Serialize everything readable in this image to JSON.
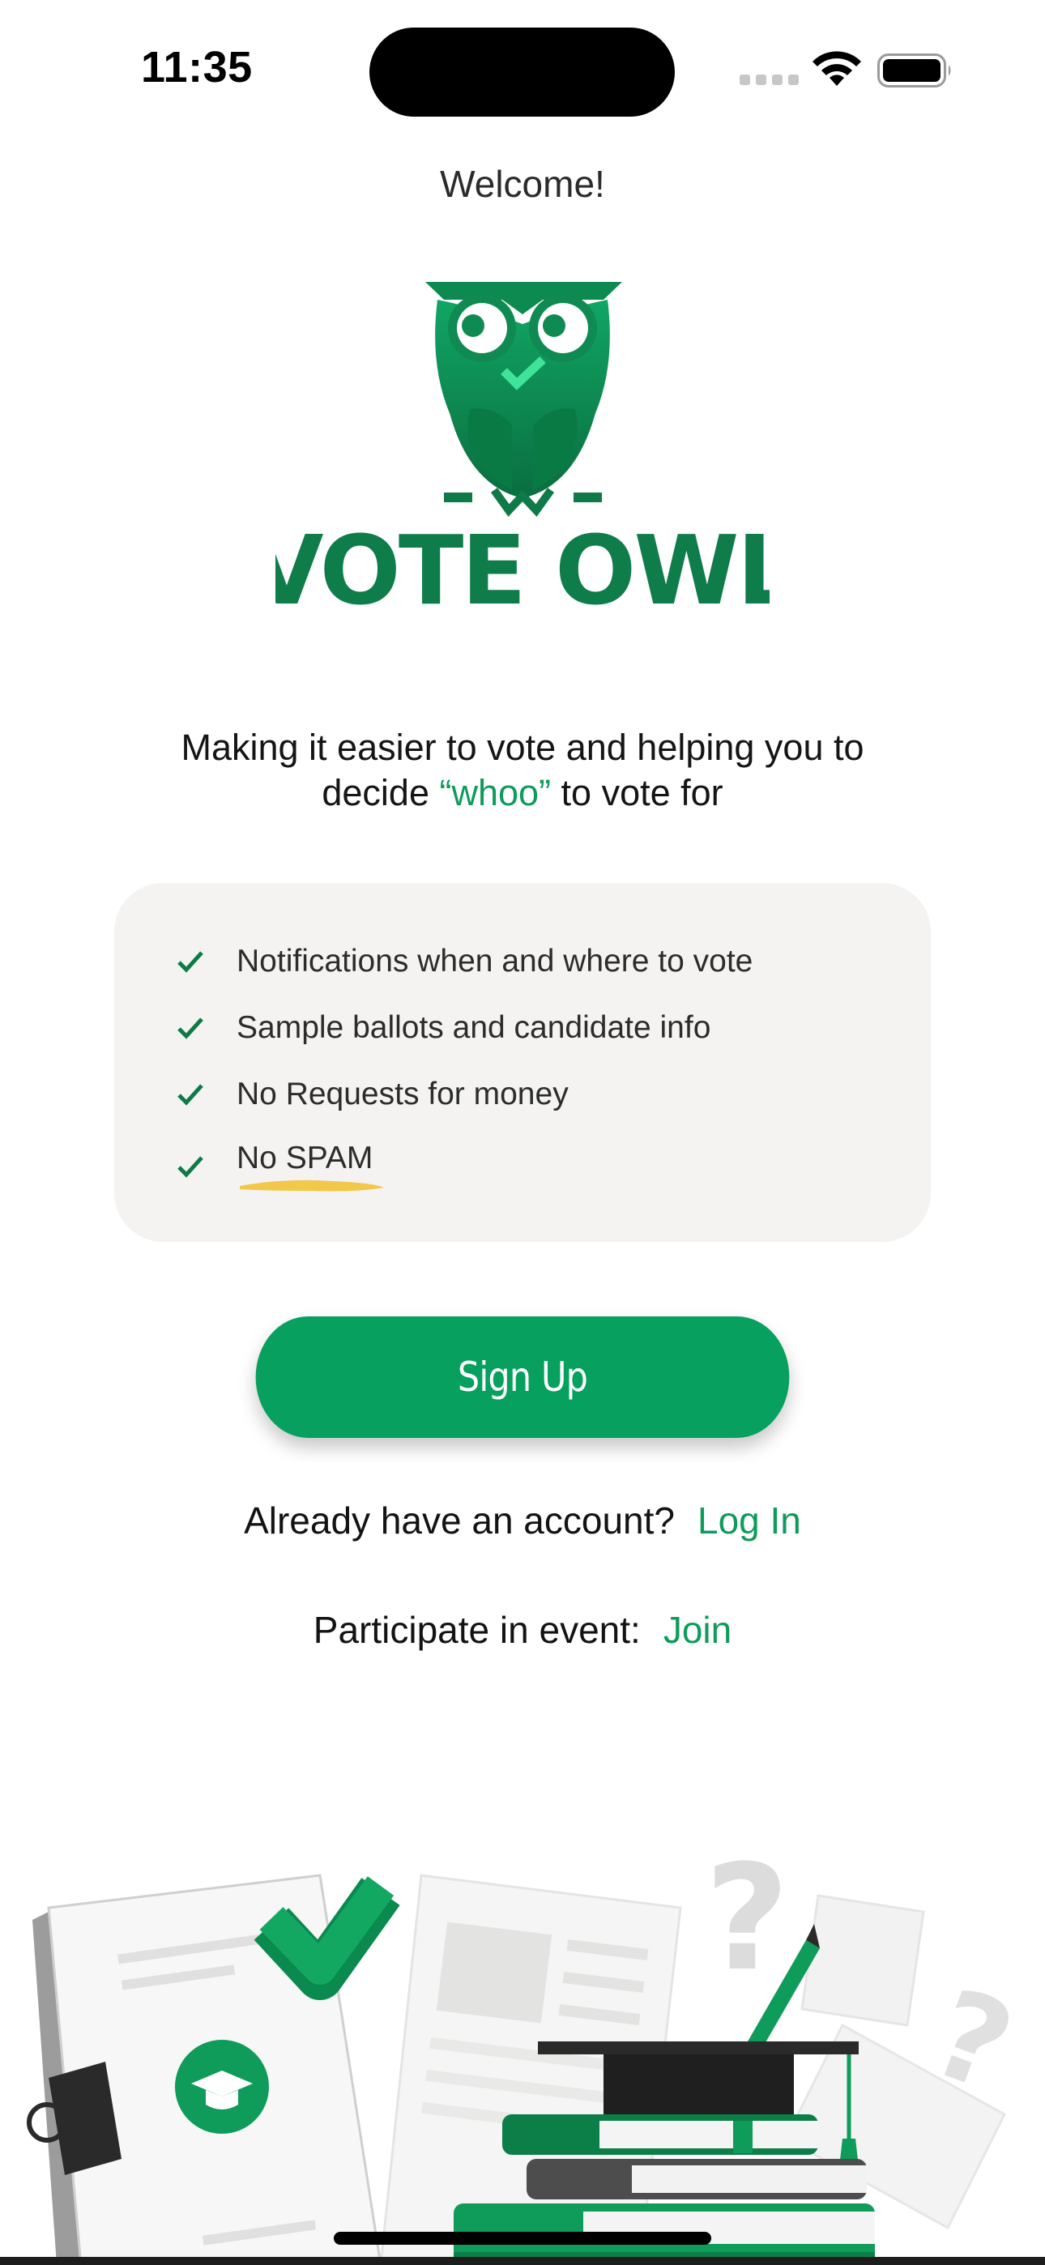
{
  "status_bar": {
    "time": "11:35",
    "icons": [
      "cellular-signal-icon",
      "wifi-icon",
      "battery-icon"
    ]
  },
  "header": {
    "welcome": "Welcome!"
  },
  "logo": {
    "brand_text": "VOTE OWL",
    "icon": "owl-logo-icon",
    "color": "#0f7d4a"
  },
  "tagline": {
    "line1": "Making it easier to vote and helping you to",
    "line2_prefix": "decide ",
    "line2_accent": "“whoo”",
    "line2_suffix": " to vote for"
  },
  "features": [
    {
      "label": "Notifications when and where to vote",
      "icon": "check-icon"
    },
    {
      "label": "Sample ballots and candidate info",
      "icon": "check-icon"
    },
    {
      "label": "No Requests for money",
      "icon": "check-icon"
    },
    {
      "label": "No SPAM",
      "icon": "check-icon"
    }
  ],
  "actions": {
    "signup_label": "Sign Up",
    "login_prompt": "Already have an account?",
    "login_link": "Log In",
    "event_prompt": "Participate in event:",
    "event_link": "Join"
  },
  "colors": {
    "brand_green": "#07a05e",
    "accent_text": "#0f9b5a",
    "card_bg": "#f4f3f1",
    "highlight_yellow": "#f2c84b"
  }
}
